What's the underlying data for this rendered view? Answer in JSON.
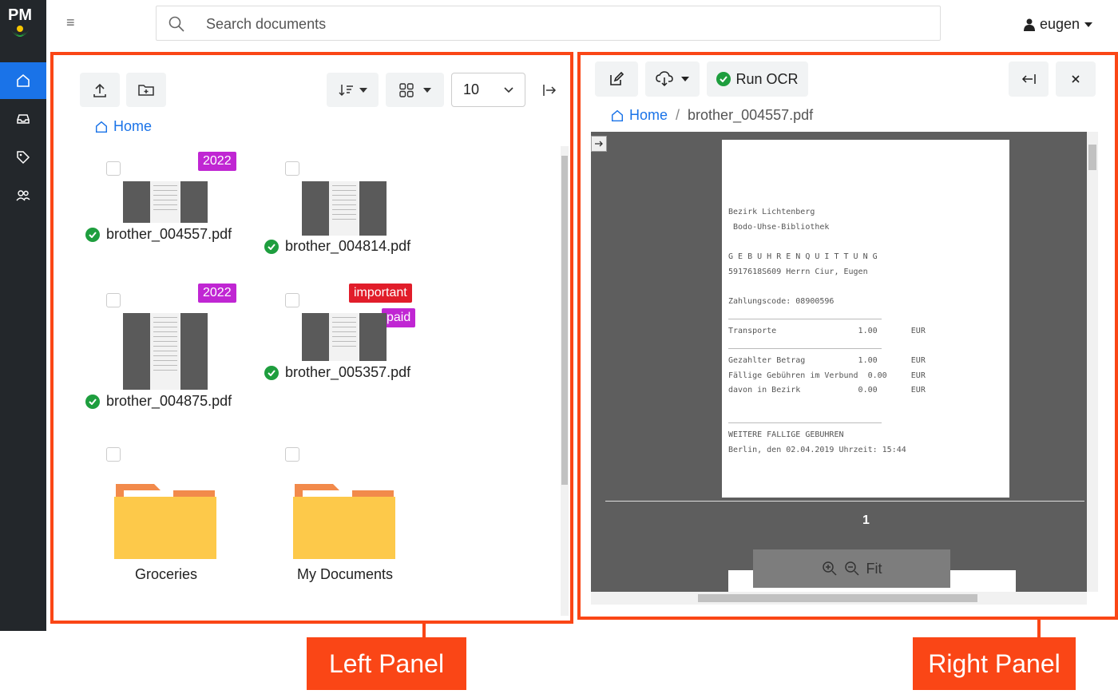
{
  "app": {
    "logo_text": "PM"
  },
  "topbar": {
    "search_placeholder": "Search documents",
    "user_name": "eugen"
  },
  "left_panel": {
    "breadcrumb_home": "Home",
    "per_page": "10",
    "documents": [
      {
        "name": "brother_004557.pdf",
        "tags": [
          "2022"
        ]
      },
      {
        "name": "brother_004814.pdf",
        "tags": []
      },
      {
        "name": "brother_004875.pdf",
        "tags": [
          "2022"
        ]
      },
      {
        "name": "brother_005357.pdf",
        "tags": [
          "important",
          "paid"
        ]
      }
    ],
    "folders": [
      {
        "name": "Groceries"
      },
      {
        "name": "My Documents"
      }
    ]
  },
  "right_panel": {
    "run_ocr_label": "Run OCR",
    "breadcrumb_home": "Home",
    "breadcrumb_current": "brother_004557.pdf",
    "page_number": "1",
    "fit_label": "Fit",
    "receipt_lines": [
      "Bezirk Lichtenberg",
      " Bodo-Uhse-Bibliothek",
      "G E B U H R E N Q U I T T U N G",
      "5917618S609 Herrn Ciur, Eugen",
      "Zahlungscode: 08900596",
      "Transporte                 1.00       EUR",
      "Gezahlter Betrag           1.00       EUR",
      "Fällige Gebühren im Verbund  0.00     EUR",
      "davon in Bezirk            0.00       EUR",
      "WEITERE FALLIGE GEBUHREN",
      "Berlin, den 02.04.2019 Uhrzeit: 15:44"
    ]
  },
  "callouts": {
    "left": "Left Panel",
    "right": "Right Panel"
  },
  "colors": {
    "accent": "#1a73e8",
    "highlight": "#fa4616",
    "tag_purple": "#c026d3",
    "tag_red": "#e11d2a",
    "success": "#1e9e3e"
  }
}
